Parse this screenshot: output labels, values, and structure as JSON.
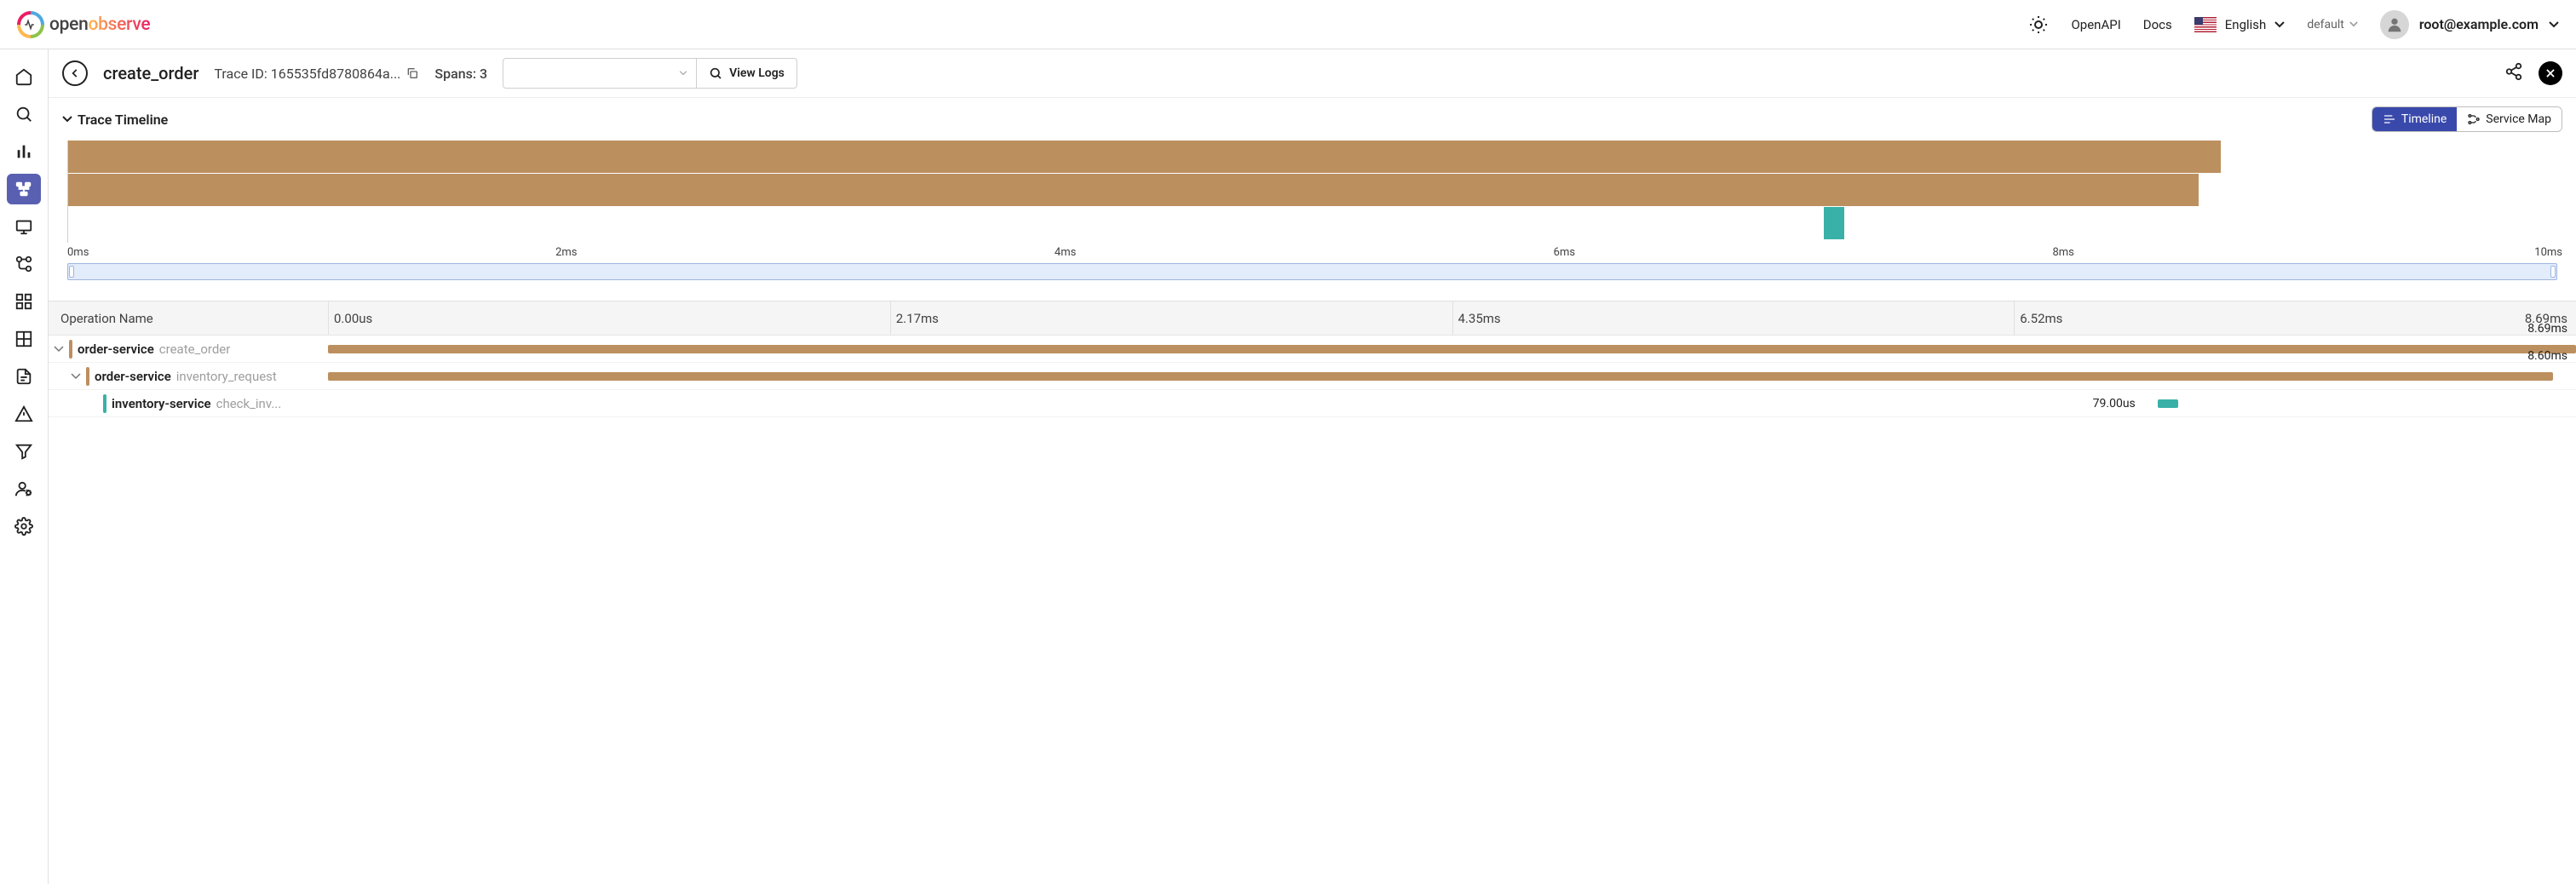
{
  "header": {
    "brand_open": "open",
    "brand_observe": "observe",
    "links": {
      "openapi": "OpenAPI",
      "docs": "Docs"
    },
    "language": "English",
    "org": "default",
    "user_email": "root@example.com"
  },
  "sidebar": {
    "items": [
      {
        "name": "home-icon"
      },
      {
        "name": "search-icon"
      },
      {
        "name": "metrics-icon"
      },
      {
        "name": "traces-icon",
        "active": true
      },
      {
        "name": "rum-icon"
      },
      {
        "name": "pipelines-icon"
      },
      {
        "name": "dashboards-icon"
      },
      {
        "name": "tables-icon"
      },
      {
        "name": "reports-icon"
      },
      {
        "name": "alerts-icon"
      },
      {
        "name": "funnels-icon"
      },
      {
        "name": "iam-icon"
      },
      {
        "name": "settings-icon"
      }
    ]
  },
  "toolbar": {
    "operation_name": "create_order",
    "trace_label": "Trace ID: 165535fd8780864a...",
    "spans_label": "Spans: 3",
    "view_logs_label": "View Logs"
  },
  "section": {
    "title": "Trace Timeline",
    "timeline_label": "Timeline",
    "servicemap_label": "Service Map"
  },
  "chart_data": {
    "type": "bar",
    "overview_total_ms": 10,
    "overview_ticks": [
      "0ms",
      "2ms",
      "4ms",
      "6ms",
      "8ms",
      "10ms"
    ],
    "overview_bars": [
      {
        "start_ms": 0,
        "duration_ms": 8.69,
        "row": 0,
        "color": "#bc8f5f"
      },
      {
        "start_ms": 0,
        "duration_ms": 8.6,
        "row": 1,
        "color": "#bc8f5f"
      },
      {
        "start_ms": 7.07,
        "duration_ms": 0.079,
        "row": 2,
        "color": "#3ab1a8"
      }
    ],
    "timeline_total_ms": 8.69,
    "timeline_ticks": [
      {
        "pos_pct": 0,
        "label": "0.00us"
      },
      {
        "pos_pct": 25,
        "label": "2.17ms"
      },
      {
        "pos_pct": 50,
        "label": "4.35ms"
      },
      {
        "pos_pct": 75,
        "label": "6.52ms"
      },
      {
        "pos_pct": 100,
        "label": "8.69ms"
      }
    ]
  },
  "span_table": {
    "header_label": "Operation Name",
    "rows": [
      {
        "indent": 0,
        "has_children": true,
        "color": "#bc8f5f",
        "service": "order-service",
        "operation": "create_order",
        "start_pct": 0,
        "width_pct": 100,
        "duration_label": "8.69ms",
        "label_above": true
      },
      {
        "indent": 1,
        "has_children": true,
        "color": "#bc8f5f",
        "service": "order-service",
        "operation": "inventory_request",
        "start_pct": 0,
        "width_pct": 98.96,
        "duration_label": "8.60ms",
        "label_above": true
      },
      {
        "indent": 2,
        "has_children": false,
        "color": "#3ab1a8",
        "service": "inventory-service",
        "operation": "check_inv...",
        "start_pct": 81.4,
        "width_pct": 0.9,
        "duration_label": "79.00us",
        "label_above": false
      }
    ]
  }
}
